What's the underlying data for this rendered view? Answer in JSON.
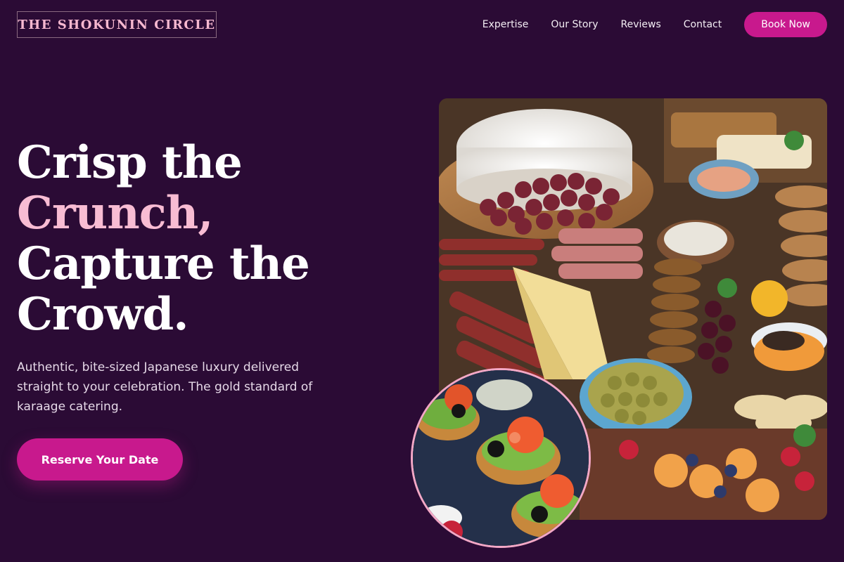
{
  "brand": {
    "logo_text": "THE SHOKUNIN CIRCLE"
  },
  "nav": {
    "items": [
      "Expertise",
      "Our Story",
      "Reviews",
      "Contact"
    ],
    "book_label": "Book Now"
  },
  "hero": {
    "headline_line1": "Crisp the",
    "headline_accent": "Crunch,",
    "headline_line3": "Capture the",
    "headline_line4": "Crowd.",
    "subtext": "Authentic, bite-sized Japanese luxury delivered straight to your celebration. The gold standard of karaage catering.",
    "cta_label": "Reserve Your Date"
  },
  "images": {
    "main_alt": "Charcuterie grazing table with cheese, grapes, crackers and cured meats",
    "round_alt": "Smoked salmon crostini with olives and microgreens"
  },
  "colors": {
    "background": "#2b0b35",
    "accent_pink": "#f8bcd3",
    "button_magenta": "#c8198d",
    "frame_pink": "#f3a8c6"
  }
}
